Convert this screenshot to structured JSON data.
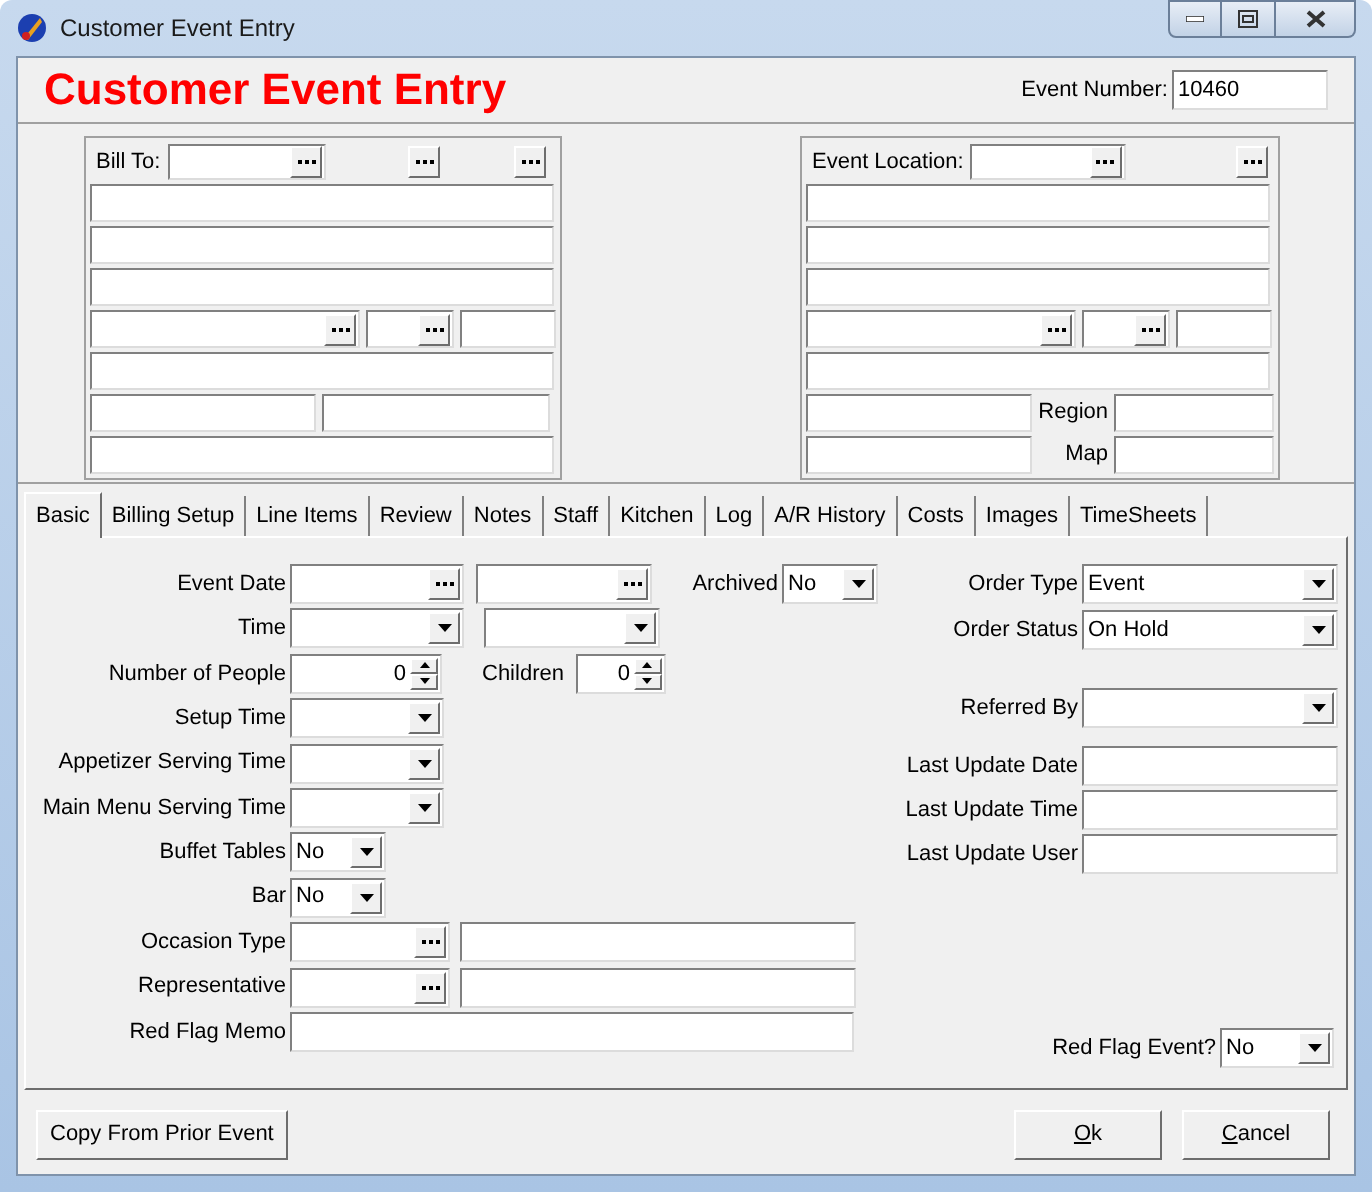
{
  "window": {
    "title": "Customer Event Entry"
  },
  "header": {
    "title": "Customer Event Entry",
    "event_number": {
      "label": "Event Number:",
      "value": "10460"
    }
  },
  "bill_to": {
    "label": "Bill To:"
  },
  "event_location": {
    "label": "Event Location:",
    "region_label": "Region",
    "map_label": "Map"
  },
  "tabs": [
    {
      "label": "Basic",
      "selected": true
    },
    {
      "label": "Billing Setup",
      "selected": false
    },
    {
      "label": "Line Items",
      "selected": false
    },
    {
      "label": "Review",
      "selected": false
    },
    {
      "label": "Notes",
      "selected": false
    },
    {
      "label": "Staff",
      "selected": false
    },
    {
      "label": "Kitchen",
      "selected": false
    },
    {
      "label": "Log",
      "selected": false
    },
    {
      "label": "A/R History",
      "selected": false
    },
    {
      "label": "Costs",
      "selected": false
    },
    {
      "label": "Images",
      "selected": false
    },
    {
      "label": "TimeSheets",
      "selected": false
    }
  ],
  "basic": {
    "left": [
      {
        "label": "Event Date",
        "kind": "date"
      },
      {
        "label": "Time",
        "kind": "time"
      },
      {
        "label": "Number of People",
        "kind": "spin",
        "value": "0",
        "extra": {
          "label": "Children",
          "value": "0"
        }
      },
      {
        "label": "Setup Time",
        "kind": "combo"
      },
      {
        "label": "Appetizer Serving Time",
        "kind": "combo"
      },
      {
        "label": "Main Menu Serving Time",
        "kind": "combo"
      },
      {
        "label": "Buffet Tables",
        "kind": "yesno",
        "value": "No"
      },
      {
        "label": "Bar",
        "kind": "yesno",
        "value": "No"
      },
      {
        "label": "Occasion Type",
        "kind": "lookup"
      },
      {
        "label": "Representative",
        "kind": "lookup"
      },
      {
        "label": "Red Flag Memo",
        "kind": "memo"
      }
    ],
    "archived": {
      "label": "Archived",
      "value": "No"
    },
    "right": [
      {
        "label": "Order Type",
        "kind": "combo",
        "value": "Event"
      },
      {
        "label": "Order Status",
        "kind": "combo",
        "value": "On Hold"
      },
      {
        "label": "Referred By",
        "kind": "combo"
      },
      {
        "label": "Last Update Date",
        "kind": "text"
      },
      {
        "label": "Last Update Time",
        "kind": "text"
      },
      {
        "label": "Last Update User",
        "kind": "text"
      }
    ],
    "red_flag": {
      "label": "Red Flag Event?",
      "value": "No"
    }
  },
  "buttons": [
    {
      "label": "Copy From Prior Event",
      "mnemonic": false
    },
    {
      "label": "Ok",
      "mnemonic": true
    },
    {
      "label": "Cancel",
      "mnemonic": true
    }
  ]
}
